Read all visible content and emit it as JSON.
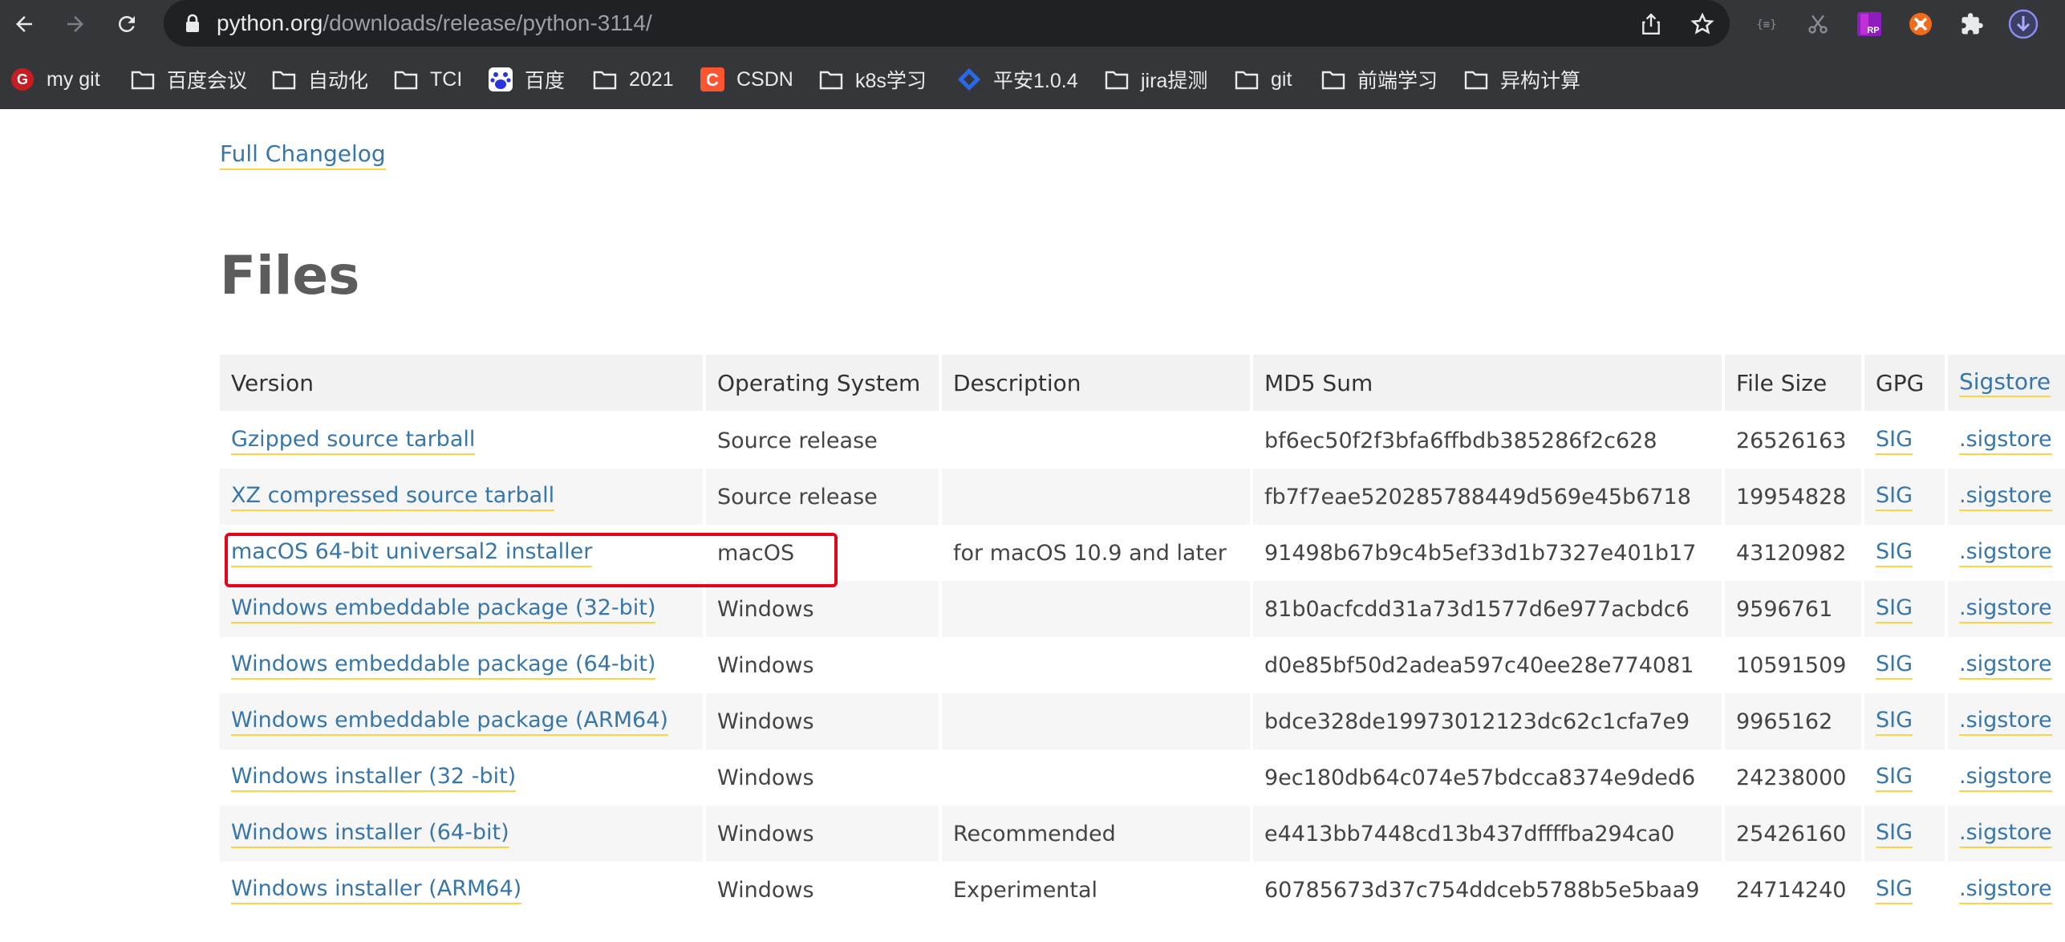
{
  "browser": {
    "url_host": "python.org",
    "url_path": "/downloads/release/python-3114/",
    "colors": {
      "chrome_bg": "#35363a",
      "omnibox_bg": "#202124"
    },
    "nav_icons": [
      "back-arrow-icon",
      "forward-arrow-icon",
      "reload-icon"
    ],
    "extensions": [
      "json-viewer-icon",
      "scissors-icon",
      "axure-rp-icon",
      "orange-circle-icon",
      "puzzle-icon",
      "download-icon"
    ]
  },
  "bookmarks": [
    {
      "label": "my git",
      "icon": "gitee-icon"
    },
    {
      "label": "百度会议",
      "icon": "folder-icon"
    },
    {
      "label": "自动化",
      "icon": "folder-icon"
    },
    {
      "label": "TCI",
      "icon": "folder-icon"
    },
    {
      "label": "百度",
      "icon": "baidu-paw-icon"
    },
    {
      "label": "2021",
      "icon": "folder-icon"
    },
    {
      "label": "CSDN",
      "icon": "csdn-icon"
    },
    {
      "label": "k8s学习",
      "icon": "folder-icon"
    },
    {
      "label": "平安1.0.4",
      "icon": "diamond-icon"
    },
    {
      "label": "jira提测",
      "icon": "folder-icon"
    },
    {
      "label": "git",
      "icon": "folder-icon"
    },
    {
      "label": "前端学习",
      "icon": "folder-icon"
    },
    {
      "label": "异构计算",
      "icon": "folder-icon"
    }
  ],
  "page": {
    "changelog_link": "Full Changelog",
    "section_title": "Files",
    "colors": {
      "link": "#3776ab",
      "underline": "#ffd343",
      "highlight": "#e1061a"
    }
  },
  "table": {
    "headers": [
      "Version",
      "Operating System",
      "Description",
      "MD5 Sum",
      "File Size",
      "GPG",
      "Sigstore"
    ],
    "rows": [
      {
        "version": "Gzipped source tarball",
        "os": "Source release",
        "description": "",
        "md5": "bf6ec50f2f3bfa6ffbdb385286f2c628",
        "size": "26526163",
        "gpg": "SIG",
        "sigstore": ".sigstore"
      },
      {
        "version": "XZ compressed source tarball",
        "os": "Source release",
        "description": "",
        "md5": "fb7f7eae520285788449d569e45b6718",
        "size": "19954828",
        "gpg": "SIG",
        "sigstore": ".sigstore"
      },
      {
        "version": "macOS 64-bit universal2 installer",
        "os": "macOS",
        "description": "for macOS 10.9 and later",
        "md5": "91498b67b9c4b5ef33d1b7327e401b17",
        "size": "43120982",
        "gpg": "SIG",
        "sigstore": ".sigstore"
      },
      {
        "version": "Windows embeddable package (32-bit)",
        "os": "Windows",
        "description": "",
        "md5": "81b0acfcdd31a73d1577d6e977acbdc6",
        "size": "9596761",
        "gpg": "SIG",
        "sigstore": ".sigstore"
      },
      {
        "version": "Windows embeddable package (64-bit)",
        "os": "Windows",
        "description": "",
        "md5": "d0e85bf50d2adea597c40ee28e774081",
        "size": "10591509",
        "gpg": "SIG",
        "sigstore": ".sigstore"
      },
      {
        "version": "Windows embeddable package (ARM64)",
        "os": "Windows",
        "description": "",
        "md5": "bdce328de19973012123dc62c1cfa7e9",
        "size": "9965162",
        "gpg": "SIG",
        "sigstore": ".sigstore"
      },
      {
        "version": "Windows installer (32 -bit)",
        "os": "Windows",
        "description": "",
        "md5": "9ec180db64c074e57bdcca8374e9ded6",
        "size": "24238000",
        "gpg": "SIG",
        "sigstore": ".sigstore"
      },
      {
        "version": "Windows installer (64-bit)",
        "os": "Windows",
        "description": "Recommended",
        "md5": "e4413bb7448cd13b437dffffba294ca0",
        "size": "25426160",
        "gpg": "SIG",
        "sigstore": ".sigstore"
      },
      {
        "version": "Windows installer (ARM64)",
        "os": "Windows",
        "description": "Experimental",
        "md5": "60785673d37c754ddceb5788b5e5baa9",
        "size": "24714240",
        "gpg": "SIG",
        "sigstore": ".sigstore"
      }
    ]
  }
}
